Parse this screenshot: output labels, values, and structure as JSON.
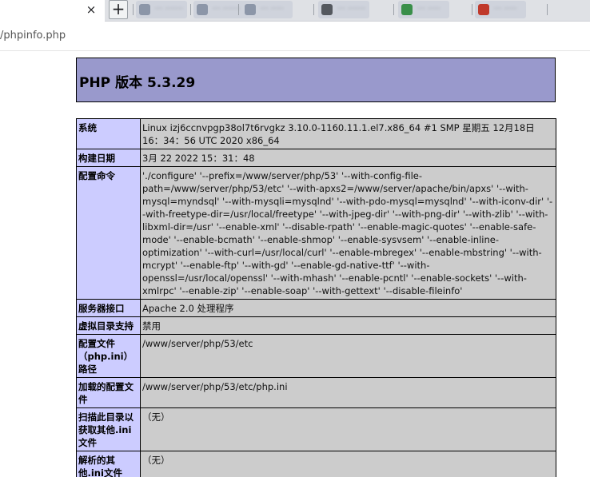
{
  "browser": {
    "active_tab": {
      "close_glyph": "×"
    },
    "new_tab_glyph": "+",
    "background_tabs": [
      {
        "label": "··· ·······"
      },
      {
        "label": "··· ·······"
      },
      {
        "label": "··· ·····"
      },
      {
        "label": "··· ·······"
      },
      {
        "label": "··· ·····"
      },
      {
        "label": "··· ·····"
      }
    ],
    "favicon_colors": [
      "#8c96a8",
      "#8c96a8",
      "#8c96a8",
      "#55595f",
      "#3a8f4a",
      "#c0392b"
    ],
    "address": {
      "url": "/phpinfo.php"
    }
  },
  "phpinfo": {
    "title": "PHP 版本 5.3.29",
    "header_color": "#9999cc",
    "key_color": "#ccccff",
    "value_color": "#cccccc",
    "rows": [
      {
        "key": "系统",
        "value": "Linux izj6ccnvpgp38ol7t6rvgkz 3.10.0-1160.11.1.el7.x86_64 #1 SMP 星期五 12月18日 16：34：56 UTC 2020 x86_64"
      },
      {
        "key": "构建日期",
        "value": "3月 22 2022 15：31：48"
      },
      {
        "key": "配置命令",
        "value": "'./configure' '--prefix=/www/server/php/53' '--with-config-file-path=/www/server/php/53/etc' '--with-apxs2=/www/server/apache/bin/apxs' '--with-mysql=myndsql' '--with-mysqli=mysqlnd' '--with-pdo-mysql=mysqlnd' '--with-iconv-dir' '--with-freetype-dir=/usr/local/freetype' '--with-jpeg-dir' '--with-png-dir' '--with-zlib' '--with-libxml-dir=/usr' '--enable-xml' '--disable-rpath' '--enable-magic-quotes' '--enable-safe-mode' '--enable-bcmath' '--enable-shmop' '--enable-sysvsem' '--enable-inline-optimization' '--with-curl=/usr/local/curl' '--enable-mbregex' '--enable-mbstring' '--with-mcrypt' '--enable-ftp' '--with-gd' '--enable-gd-native-ttf' '--with-openssl=/usr/local/openssl' '--with-mhash' '--enable-pcntl' '--enable-sockets' '--with-xmlrpc' '--enable-zip' '--enable-soap' '--with-gettext' '--disable-fileinfo'"
      },
      {
        "key": "服务器接口",
        "value": "Apache 2.0 处理程序"
      },
      {
        "key": "虚拟目录支持",
        "value": "禁用"
      },
      {
        "key": "配置文件（php.ini）路径",
        "value": "/www/server/php/53/etc"
      },
      {
        "key": "加载的配置文件",
        "value": "/www/server/php/53/etc/php.ini"
      },
      {
        "key": "扫描此目录以获取其他.ini文件",
        "value": "（无）"
      },
      {
        "key": "解析的其他.ini文件",
        "value": "（无）"
      }
    ]
  }
}
